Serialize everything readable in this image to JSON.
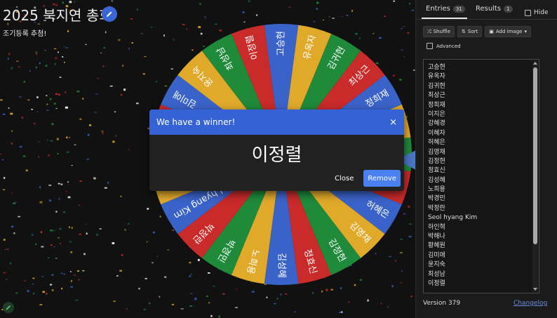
{
  "header": {
    "title": "2025 북지연 총회",
    "subtitle": "조기등록 추첨!"
  },
  "wheel": {
    "colors": [
      "#3a63c9",
      "#e0a92a",
      "#1e8a3a",
      "#c92a2a"
    ],
    "labels": [
      "고승현",
      "유옥자",
      "김귀현",
      "최상근",
      "정희재",
      "이지은",
      "강혜경",
      "이혜자",
      "허혜은",
      "김영채",
      "김정현",
      "정효신",
      "김성혜",
      "노희용",
      "박경민",
      "박정란",
      "Seol hyang Kim",
      "하인혁",
      "박해나",
      "황혜원",
      "김미애",
      "윤지숙",
      "최성남",
      "이정렬"
    ]
  },
  "dialog": {
    "heading": "We have a winner!",
    "close_x": "×",
    "winner": "이정렬",
    "close_label": "Close",
    "remove_label": "Remove"
  },
  "panel": {
    "tabs": [
      {
        "label": "Entries",
        "count": "31"
      },
      {
        "label": "Results",
        "count": "1"
      }
    ],
    "hide_label": "Hide",
    "toolbar": {
      "shuffle": "Shuffle",
      "sort": "Sort",
      "add_image": "Add image"
    },
    "advanced_label": "Advanced",
    "entries": [
      "고승현",
      "유옥자",
      "김귀현",
      "최상근",
      "정희재",
      "이지은",
      "강혜경",
      "이혜자",
      "허혜은",
      "김영채",
      "김정현",
      "정효신",
      "김성혜",
      "노희용",
      "박경민",
      "박정란",
      "Seol hyang Kim",
      "하인혁",
      "박해나",
      "황혜원",
      "김미애",
      "윤지숙",
      "최성남",
      "이정렬"
    ],
    "version": "Version 379",
    "changelog": "Changelog"
  }
}
